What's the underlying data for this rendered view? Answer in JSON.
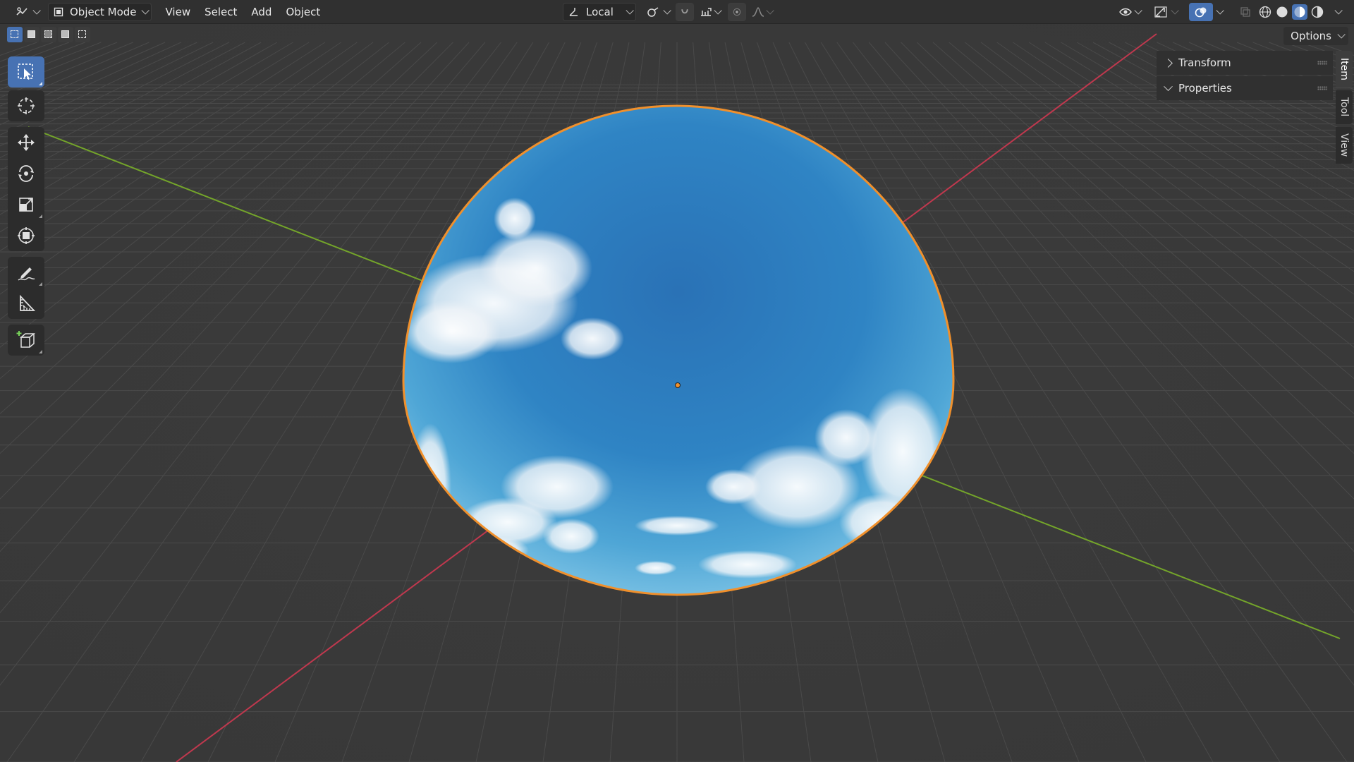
{
  "header": {
    "mode": "Object Mode",
    "menus": [
      "View",
      "Select",
      "Add",
      "Object"
    ],
    "transform_orientation": "Local"
  },
  "options_label": "Options",
  "sidebar_panels": [
    {
      "label": "Transform",
      "expanded": false
    },
    {
      "label": "Properties",
      "expanded": true
    }
  ],
  "sidebar_tabs": [
    "Item",
    "Tool",
    "View"
  ],
  "toolbar": [
    "select-box-tool",
    "cursor-tool",
    "move-tool",
    "rotate-tool",
    "scale-tool",
    "transform-tool",
    "annotate-tool",
    "measure-tool",
    "add-cube-tool"
  ],
  "colors": {
    "selection_outline": "#f0902c",
    "x_axis": "#c0384e",
    "y_axis": "#74a52a",
    "active_tool": "#4772b3",
    "sky_top": "#2a72b8",
    "sky_edge": "#5fb0dc"
  }
}
